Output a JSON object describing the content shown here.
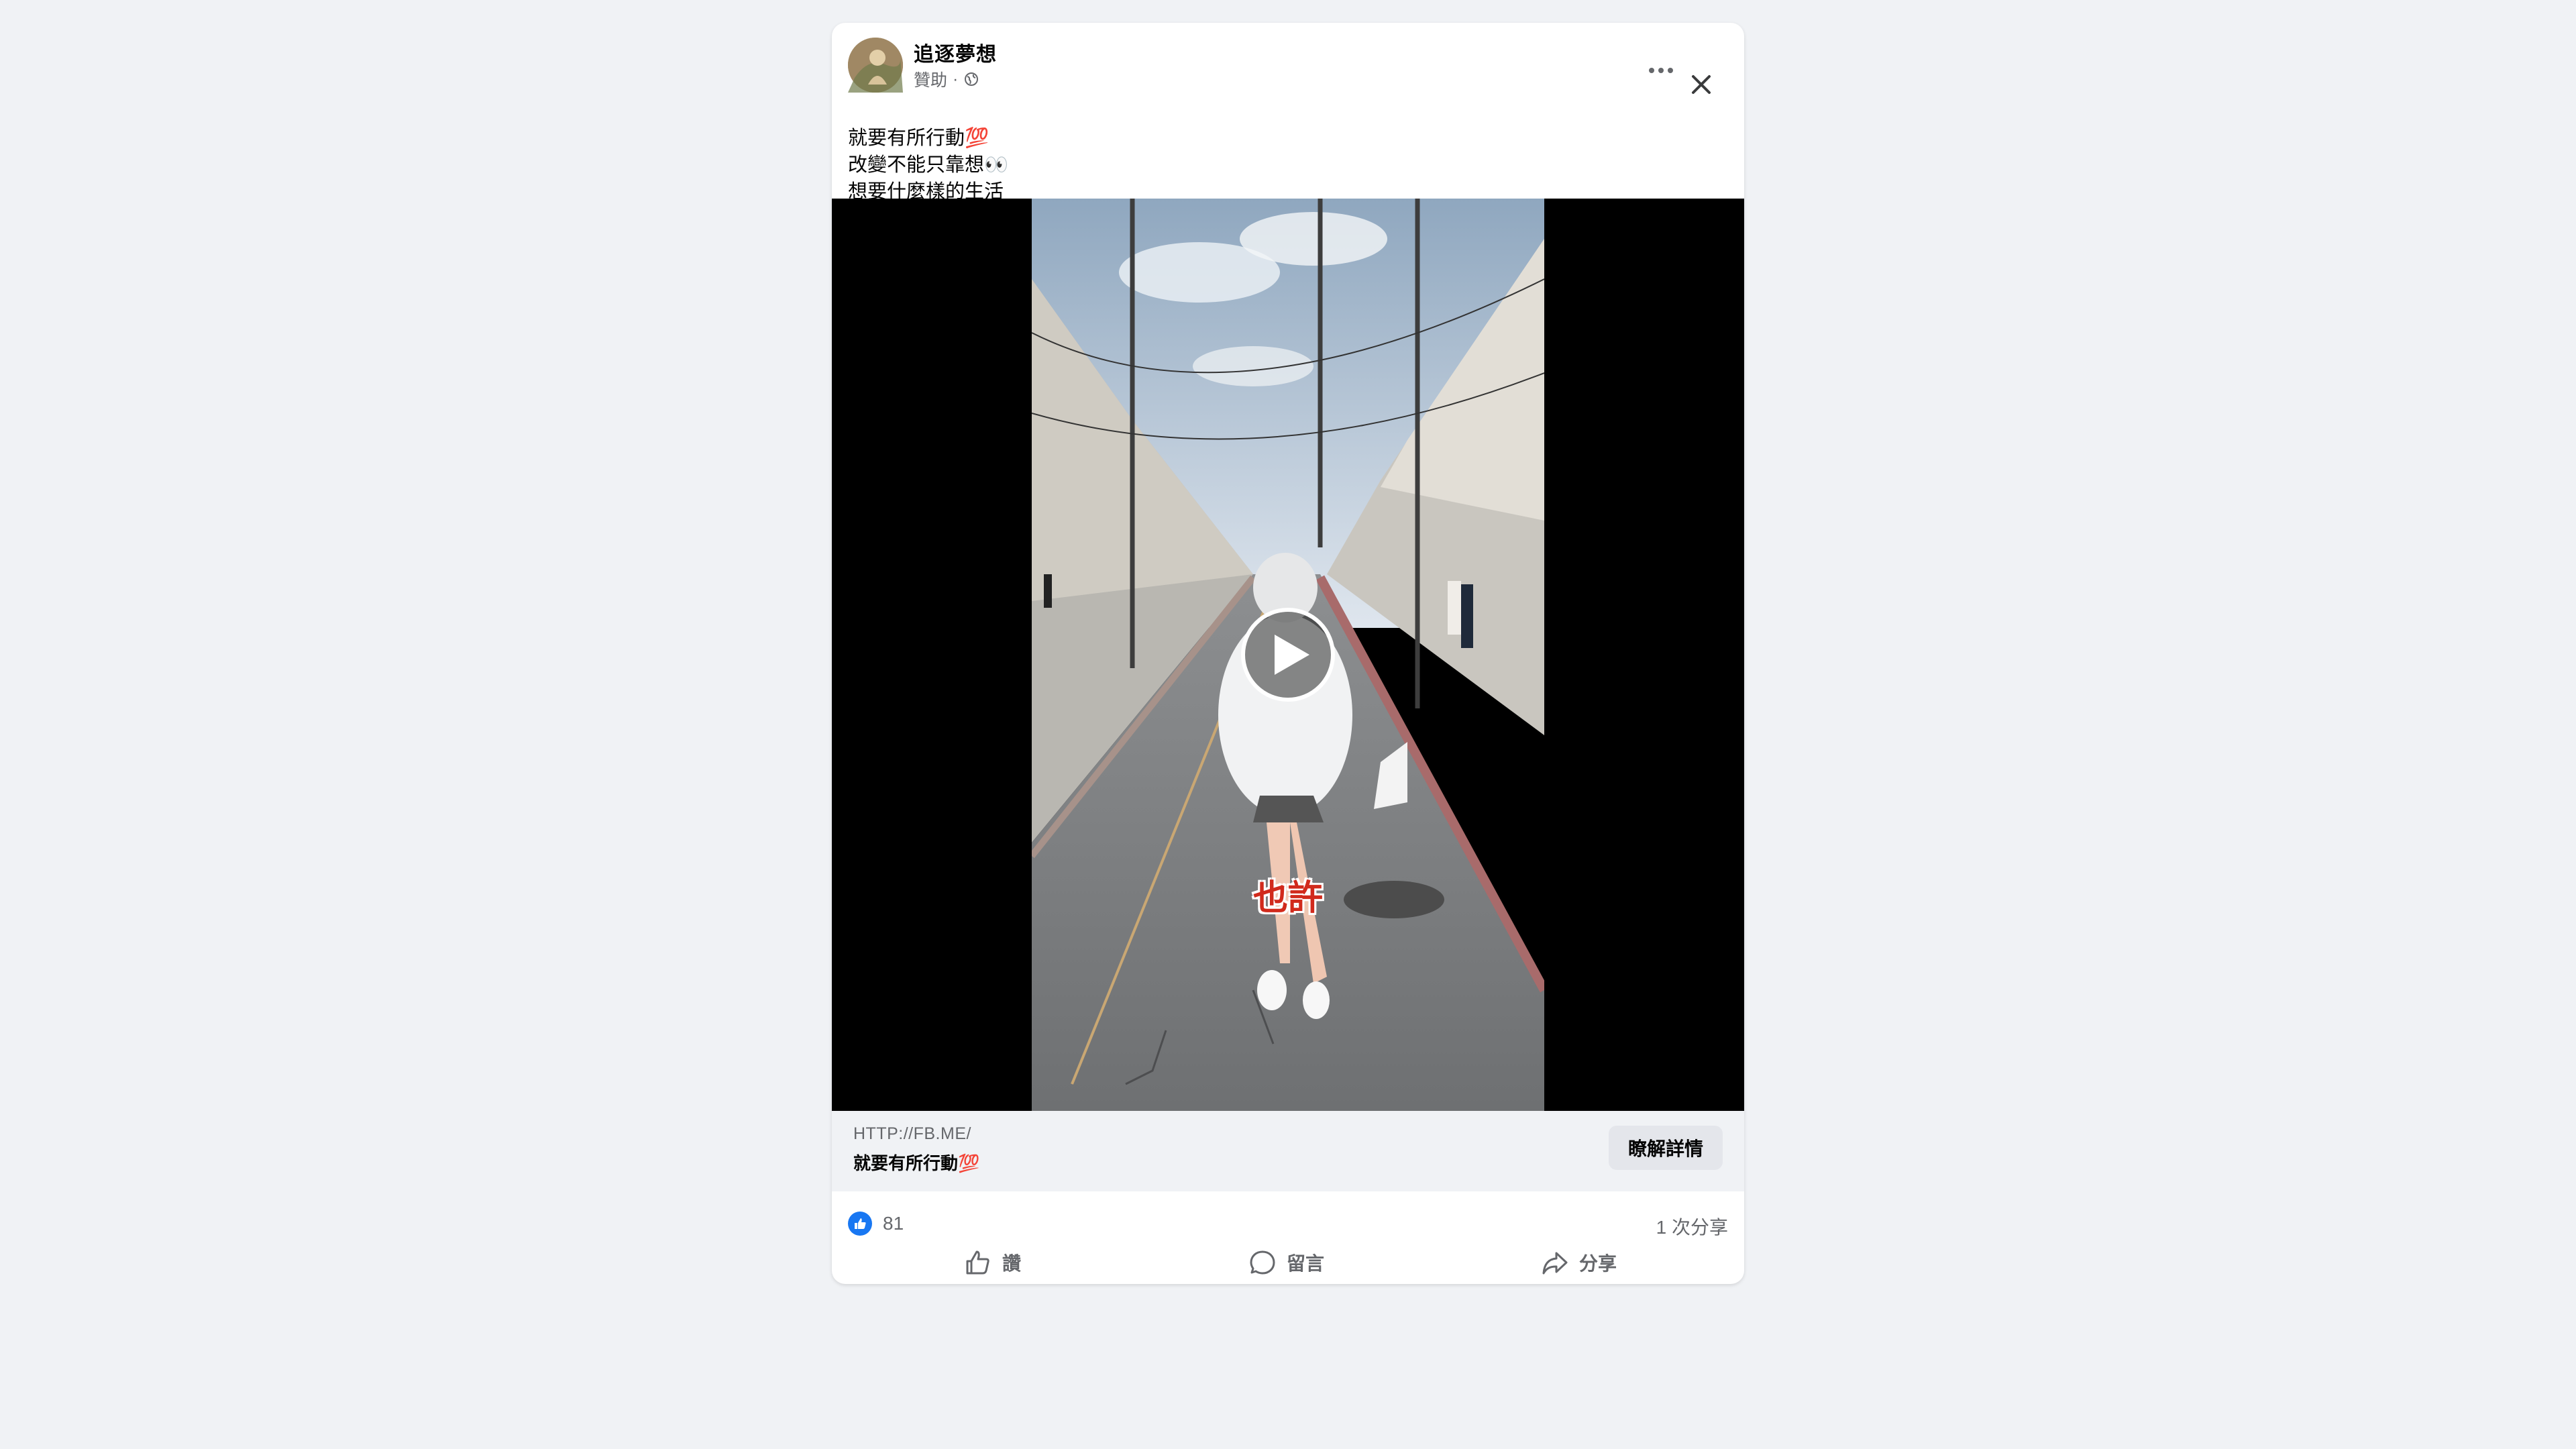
{
  "post": {
    "page_name": "追逐夢想",
    "meta_label": "贊助",
    "meta_separator": "·",
    "caption_lines": [
      "就要有所行動💯",
      "改變不能只靠想👀",
      "想要什麼樣的生活"
    ],
    "video": {
      "subtitle": "也許"
    },
    "link": {
      "url": "HTTP://FB.ME/",
      "title": "就要有所行動💯",
      "cta_label": "瞭解詳情"
    },
    "stats": {
      "likes": "81",
      "shares": "1 次分享"
    },
    "actions": {
      "like": "讚",
      "comment": "留言",
      "share": "分享"
    }
  },
  "colors": {
    "background": "#f0f2f5",
    "card": "#ffffff",
    "like_blue": "#1877f2",
    "subtitle_red": "#d12a1c"
  },
  "icons": [
    "avatar",
    "globe-icon",
    "more-icon",
    "close-icon",
    "play-icon",
    "like-icon",
    "comment-icon",
    "share-icon"
  ]
}
